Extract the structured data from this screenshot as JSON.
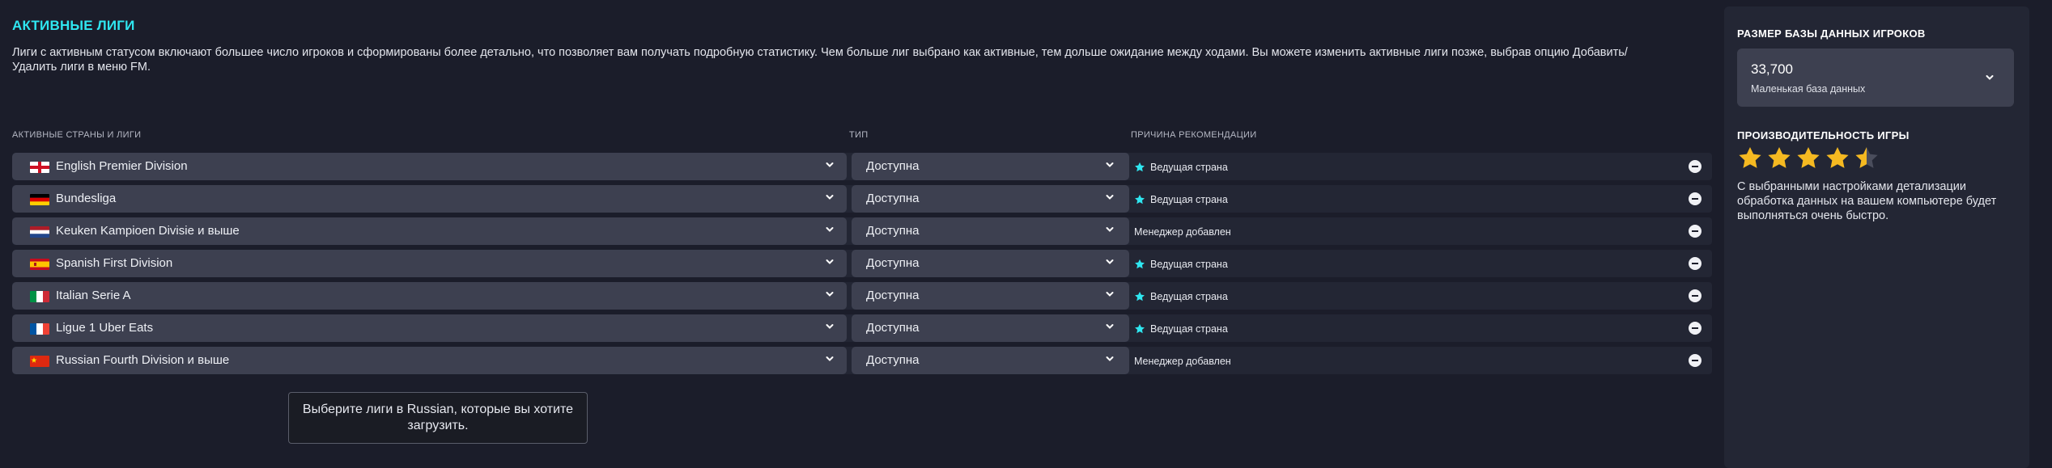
{
  "page": {
    "title": "АКТИВНЫЕ ЛИГИ",
    "description": "Лиги с активным статусом включают большее число игроков и сформированы более детально, что позволяет вам получать подробную статистику. Чем больше лиг выбрано как активные, тем дольше ожидание между ходами. Вы можете изменить активные лиги позже, выбрав опцию Добавить/Удалить лиги в меню FM."
  },
  "columns": {
    "leagues": "АКТИВНЫЕ СТРАНЫ И ЛИГИ",
    "type": "ТИП",
    "reason": "ПРИЧИНА РЕКОМЕНДАЦИИ"
  },
  "rows": [
    {
      "league": "English Premier Division",
      "flag": "england-flag-icon",
      "type": "Доступна",
      "reason": "Ведущая страна",
      "starred": true
    },
    {
      "league": "Bundesliga",
      "flag": "germany-flag-icon",
      "type": "Доступна",
      "reason": "Ведущая страна",
      "starred": true
    },
    {
      "league": "Keuken Kampioen Divisie и выше",
      "flag": "netherlands-flag-icon",
      "type": "Доступна",
      "reason": "Менеджер добавлен",
      "starred": false
    },
    {
      "league": "Spanish First Division",
      "flag": "spain-flag-icon",
      "type": "Доступна",
      "reason": "Ведущая страна",
      "starred": true
    },
    {
      "league": "Italian Serie A",
      "flag": "italy-flag-icon",
      "type": "Доступна",
      "reason": "Ведущая страна",
      "starred": true
    },
    {
      "league": "Ligue 1 Uber Eats",
      "flag": "france-flag-icon",
      "type": "Доступна",
      "reason": "Ведущая страна",
      "starred": true
    },
    {
      "league": "Russian Fourth Division и выше",
      "flag": "china-flag-icon",
      "type": "Доступна",
      "reason": "Менеджер добавлен",
      "starred": false
    }
  ],
  "tooltip": "Выберите лиги в Russian, которые вы хотите загрузить.",
  "sidebar": {
    "db_heading": "РАЗМЕР БАЗЫ ДАННЫХ ИГРОКОВ",
    "db_value": "33,700",
    "db_label": "Маленькая база данных",
    "perf_heading": "ПРОИЗВОДИТЕЛЬНОСТЬ ИГРЫ",
    "perf_rating": 4.5,
    "perf_rating_max": 5,
    "perf_text": "С выбранными настройками детализации обработка данных на вашем компьютере будет выполняться очень быстро."
  },
  "colors": {
    "accent": "#2fe6f0",
    "star_gold": "#f5b921",
    "background": "#1b1d2a",
    "panel": "#232634",
    "control": "#3d4050"
  }
}
